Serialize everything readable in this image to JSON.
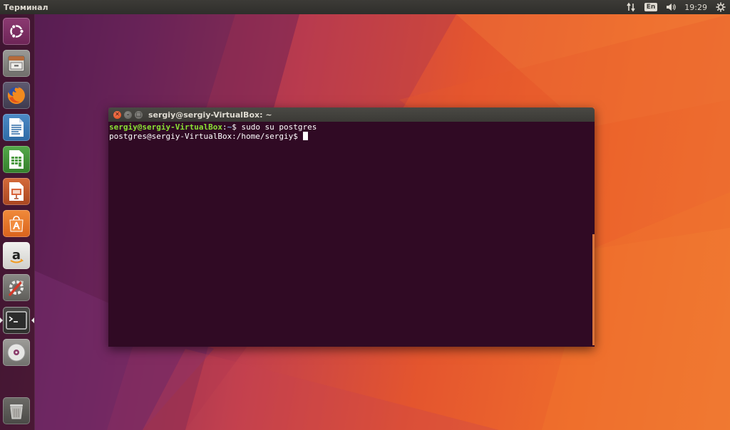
{
  "top_panel": {
    "app_title": "Терминал",
    "network_icon": "network-updown-icon",
    "keyboard_layout": "En",
    "volume_icon": "volume-icon",
    "clock": "19:29",
    "system_menu_icon": "gear-icon"
  },
  "launcher": {
    "items": [
      {
        "name": "ubuntu-dash",
        "icon": "ubuntu-logo-icon"
      },
      {
        "name": "files",
        "icon": "file-cabinet-icon"
      },
      {
        "name": "firefox",
        "icon": "firefox-icon"
      },
      {
        "name": "libreoffice-writer",
        "icon": "writer-document-icon"
      },
      {
        "name": "libreoffice-calc",
        "icon": "calc-spreadsheet-icon"
      },
      {
        "name": "libreoffice-impress",
        "icon": "impress-presentation-icon"
      },
      {
        "name": "ubuntu-software",
        "icon": "software-bag-icon"
      },
      {
        "name": "amazon",
        "icon": "amazon-logo-icon"
      },
      {
        "name": "system-settings",
        "icon": "settings-tools-icon"
      },
      {
        "name": "terminal",
        "icon": "terminal-icon",
        "active": true
      },
      {
        "name": "dvd-drive",
        "icon": "disc-icon"
      },
      {
        "name": "trash",
        "icon": "trash-icon"
      }
    ]
  },
  "terminal": {
    "title": "sergiy@sergiy-VirtualBox: ~",
    "lines": [
      {
        "user_host": "sergiy@sergiy-VirtualBox",
        "sep": ":",
        "path": "~",
        "suffix": "$ sudo su postgres"
      },
      {
        "plain": "postgres@sergiy-VirtualBox:/home/sergiy$ "
      }
    ]
  },
  "colors": {
    "terminal_bg": "#300a24",
    "prompt_user": "#8ae234",
    "prompt_path": "#729fcf",
    "close_button": "#df4a16"
  }
}
